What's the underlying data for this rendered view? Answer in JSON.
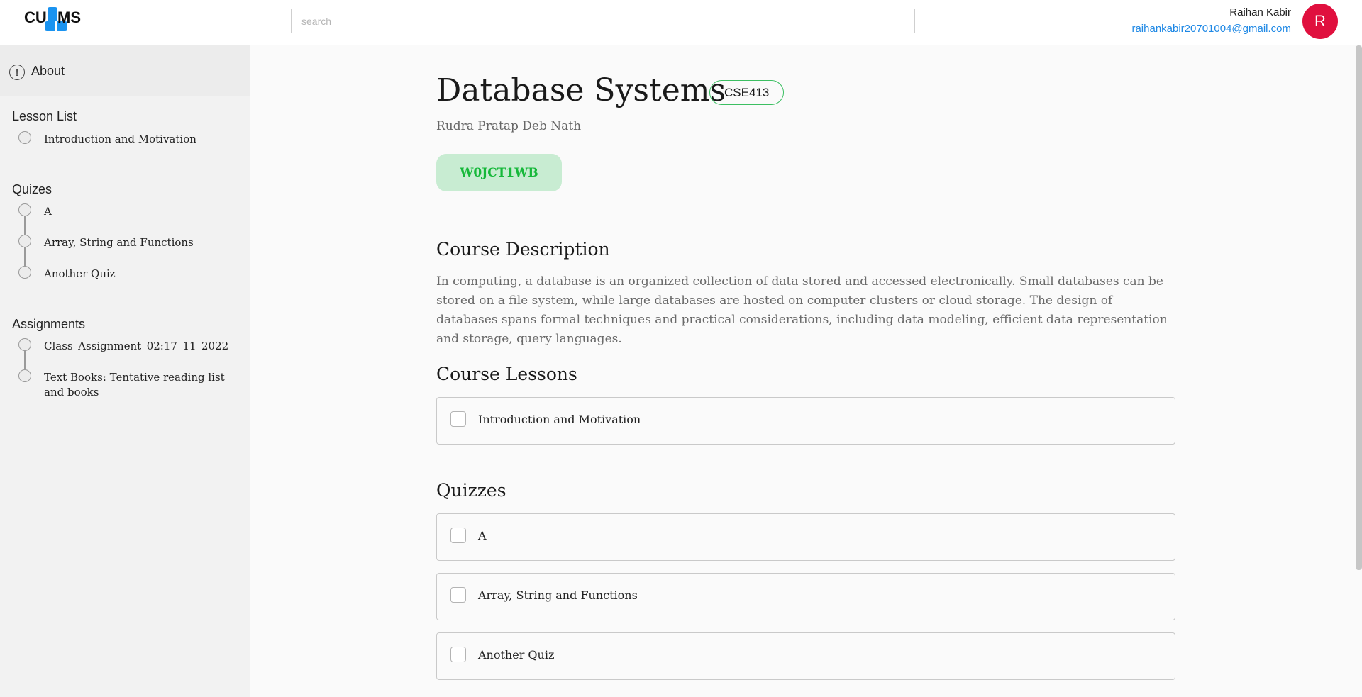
{
  "header": {
    "logo_left": "CU",
    "logo_right": "MS",
    "search_placeholder": "search",
    "user_name": "Raihan Kabir",
    "user_email": "raihankabir20701004@gmail.com",
    "avatar_initial": "R",
    "avatar_color": "#e0103e"
  },
  "sidebar": {
    "about_label": "About",
    "lessons_title": "Lesson List",
    "lessons": [
      "Introduction and Motivation"
    ],
    "quizzes_title": "Quizes",
    "quizzes": [
      "A",
      "Array, String and Functions",
      "Another Quiz"
    ],
    "assignments_title": "Assignments",
    "assignments": [
      "Class_Assignment_02:17_11_2022",
      "Text Books: Tentative reading list and books"
    ]
  },
  "main": {
    "title": "Database Systems",
    "course_code": "CSE413",
    "instructor": "Rudra Pratap Deb Nath",
    "join_code": "W0JCT1WB",
    "description_heading": "Course Description",
    "description": "In computing, a database is an organized collection of data stored and accessed electronically. Small databases can be stored on a file system, while large databases are hosted on computer clusters or cloud storage. The design of databases spans formal techniques and practical considerations, including data modeling, efficient data representation and storage, query languages.",
    "lessons_heading": "Course Lessons",
    "lessons": [
      "Introduction and Motivation"
    ],
    "quizzes_heading": "Quizzes",
    "quizzes": [
      "A",
      "Array, String and Functions",
      "Another Quiz"
    ]
  },
  "colors": {
    "accent_blue": "#1e88e5",
    "badge_green": "#3cbf62",
    "join_code_bg": "#c8ecd2",
    "join_code_text": "#16b83a"
  }
}
